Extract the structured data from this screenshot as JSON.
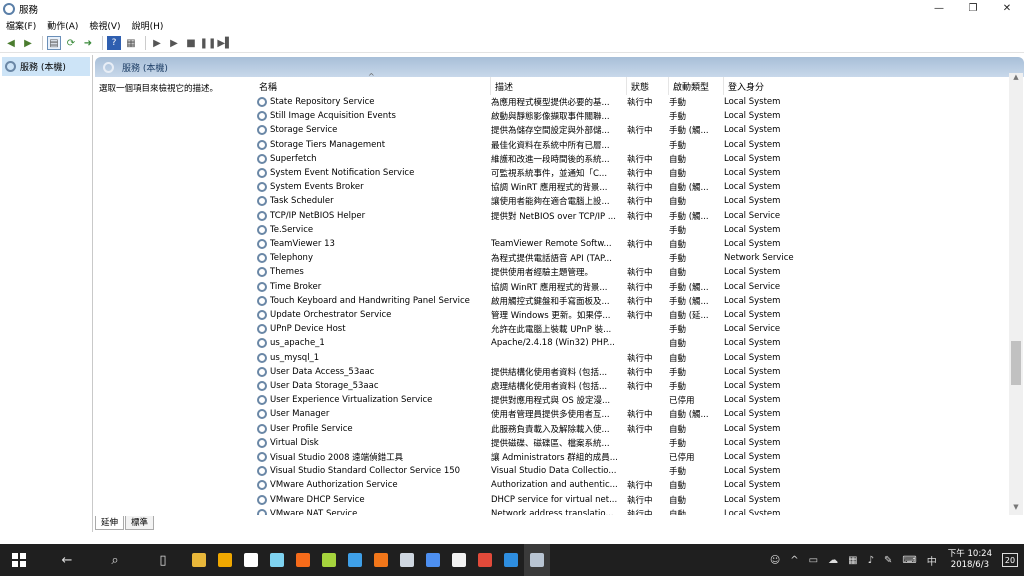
{
  "window": {
    "title": "服務",
    "minimize": "—",
    "maximize": "❐",
    "close": "✕"
  },
  "menu": [
    "檔案(F)",
    "動作(A)",
    "檢視(V)",
    "說明(H)"
  ],
  "toolbar_icons": [
    "back-icon",
    "forward-icon",
    "console-tree-icon",
    "refresh-icon",
    "export-icon",
    "help-icon",
    "properties-icon",
    "start-icon",
    "start-alt-icon",
    "stop-icon",
    "pause-icon",
    "restart-icon"
  ],
  "tree": {
    "root": "服務 (本機)"
  },
  "panel": {
    "header": "服務 (本機)",
    "description_hint": "選取一個項目來檢視它的描述。"
  },
  "columns": {
    "name": "名稱",
    "description": "描述",
    "status": "狀態",
    "startup": "啟動類型",
    "logon": "登入身分"
  },
  "services": [
    {
      "name": "State Repository Service",
      "desc": "為應用程式模型提供必要的基...",
      "status": "執行中",
      "startup": "手動",
      "logon": "Local System"
    },
    {
      "name": "Still Image Acquisition Events",
      "desc": "啟動與靜態影像擷取事件關聯...",
      "status": "",
      "startup": "手動",
      "logon": "Local System"
    },
    {
      "name": "Storage Service",
      "desc": "提供為儲存空間設定與外部儲...",
      "status": "執行中",
      "startup": "手動 (觸...",
      "logon": "Local System"
    },
    {
      "name": "Storage Tiers Management",
      "desc": "最佳化資料在系統中所有已層...",
      "status": "",
      "startup": "手動",
      "logon": "Local System"
    },
    {
      "name": "Superfetch",
      "desc": "維護和改進一段時間後的系統...",
      "status": "執行中",
      "startup": "自動",
      "logon": "Local System"
    },
    {
      "name": "System Event Notification Service",
      "desc": "可監視系統事件，並通知「C...",
      "status": "執行中",
      "startup": "自動",
      "logon": "Local System"
    },
    {
      "name": "System Events Broker",
      "desc": "協調 WinRT 應用程式的背景...",
      "status": "執行中",
      "startup": "自動 (觸...",
      "logon": "Local System"
    },
    {
      "name": "Task Scheduler",
      "desc": "讓使用者能夠在適合電腦上設...",
      "status": "執行中",
      "startup": "自動",
      "logon": "Local System"
    },
    {
      "name": "TCP/IP NetBIOS Helper",
      "desc": "提供對 NetBIOS over TCP/IP ...",
      "status": "執行中",
      "startup": "手動 (觸...",
      "logon": "Local Service"
    },
    {
      "name": "Te.Service",
      "desc": "",
      "status": "",
      "startup": "手動",
      "logon": "Local System"
    },
    {
      "name": "TeamViewer 13",
      "desc": "TeamViewer Remote Softw...",
      "status": "執行中",
      "startup": "自動",
      "logon": "Local System"
    },
    {
      "name": "Telephony",
      "desc": "為程式提供電話語音 API (TAP...",
      "status": "",
      "startup": "手動",
      "logon": "Network Service"
    },
    {
      "name": "Themes",
      "desc": "提供使用者經驗主題管理。",
      "status": "執行中",
      "startup": "自動",
      "logon": "Local System"
    },
    {
      "name": "Time Broker",
      "desc": "協調 WinRT 應用程式的背景...",
      "status": "執行中",
      "startup": "手動 (觸...",
      "logon": "Local Service"
    },
    {
      "name": "Touch Keyboard and Handwriting Panel Service",
      "desc": "啟用觸控式鍵盤和手寫面板及...",
      "status": "執行中",
      "startup": "手動 (觸...",
      "logon": "Local System"
    },
    {
      "name": "Update Orchestrator Service",
      "desc": "管理 Windows 更新。如果停...",
      "status": "執行中",
      "startup": "自動 (延...",
      "logon": "Local System"
    },
    {
      "name": "UPnP Device Host",
      "desc": "允許在此電腦上裝載 UPnP 裝...",
      "status": "",
      "startup": "手動",
      "logon": "Local Service"
    },
    {
      "name": "us_apache_1",
      "desc": "Apache/2.4.18 (Win32) PHP...",
      "status": "",
      "startup": "自動",
      "logon": "Local System"
    },
    {
      "name": "us_mysql_1",
      "desc": "",
      "status": "執行中",
      "startup": "自動",
      "logon": "Local System"
    },
    {
      "name": "User Data Access_53aac",
      "desc": "提供結構化使用者資料 (包括...",
      "status": "執行中",
      "startup": "手動",
      "logon": "Local System"
    },
    {
      "name": "User Data Storage_53aac",
      "desc": "處理結構化使用者資料 (包括...",
      "status": "執行中",
      "startup": "手動",
      "logon": "Local System"
    },
    {
      "name": "User Experience Virtualization Service",
      "desc": "提供對應用程式與 OS 設定漫...",
      "status": "",
      "startup": "已停用",
      "logon": "Local System"
    },
    {
      "name": "User Manager",
      "desc": "使用者管理員提供多使用者互...",
      "status": "執行中",
      "startup": "自動 (觸...",
      "logon": "Local System"
    },
    {
      "name": "User Profile Service",
      "desc": "此服務負責載入及解除載入使...",
      "status": "執行中",
      "startup": "自動",
      "logon": "Local System"
    },
    {
      "name": "Virtual Disk",
      "desc": "提供磁碟、磁碟區、檔案系統...",
      "status": "",
      "startup": "手動",
      "logon": "Local System"
    },
    {
      "name": "Visual Studio 2008 遠端偵錯工具",
      "desc": "讓 Administrators 群組的成員...",
      "status": "",
      "startup": "已停用",
      "logon": "Local System"
    },
    {
      "name": "Visual Studio Standard Collector Service 150",
      "desc": "Visual Studio Data Collectio...",
      "status": "",
      "startup": "手動",
      "logon": "Local System"
    },
    {
      "name": "VMware Authorization Service",
      "desc": "Authorization and authentic...",
      "status": "執行中",
      "startup": "自動",
      "logon": "Local System"
    },
    {
      "name": "VMware DHCP Service",
      "desc": "DHCP service for virtual net...",
      "status": "執行中",
      "startup": "自動",
      "logon": "Local System"
    },
    {
      "name": "VMware NAT Service",
      "desc": "Network address translatio...",
      "status": "執行中",
      "startup": "自動",
      "logon": "Local System"
    }
  ],
  "bottom_tabs": {
    "extended": "延伸",
    "standard": "標準"
  },
  "taskbar": {
    "apps": [
      {
        "icon": "file-explorer-icon",
        "color": "#e8b73a"
      },
      {
        "icon": "media-icon",
        "color": "#f0a800"
      },
      {
        "icon": "google-icon",
        "color": "#ffffff"
      },
      {
        "icon": "sticky-notes-icon",
        "color": "#7fd3f0"
      },
      {
        "icon": "tool-icon",
        "color": "#f56b1a"
      },
      {
        "icon": "lambda-icon",
        "color": "#a6d43d"
      },
      {
        "icon": "cube-icon",
        "color": "#3fa0e8"
      },
      {
        "icon": "xampp-icon",
        "color": "#f2771a"
      },
      {
        "icon": "network-icon",
        "color": "#cfd7e0"
      },
      {
        "icon": "browser-icon",
        "color": "#4d8ff0"
      },
      {
        "icon": "photos-icon",
        "color": "#f2f2f2"
      },
      {
        "icon": "chrome-icon",
        "color": "#e24a3a"
      },
      {
        "icon": "edge-icon",
        "color": "#2e8ee0"
      },
      {
        "icon": "services-icon",
        "color": "#b8c4d2"
      }
    ],
    "ime": "中",
    "time": "下午 10:24",
    "date": "2018/6/3",
    "notification_count": "20"
  }
}
